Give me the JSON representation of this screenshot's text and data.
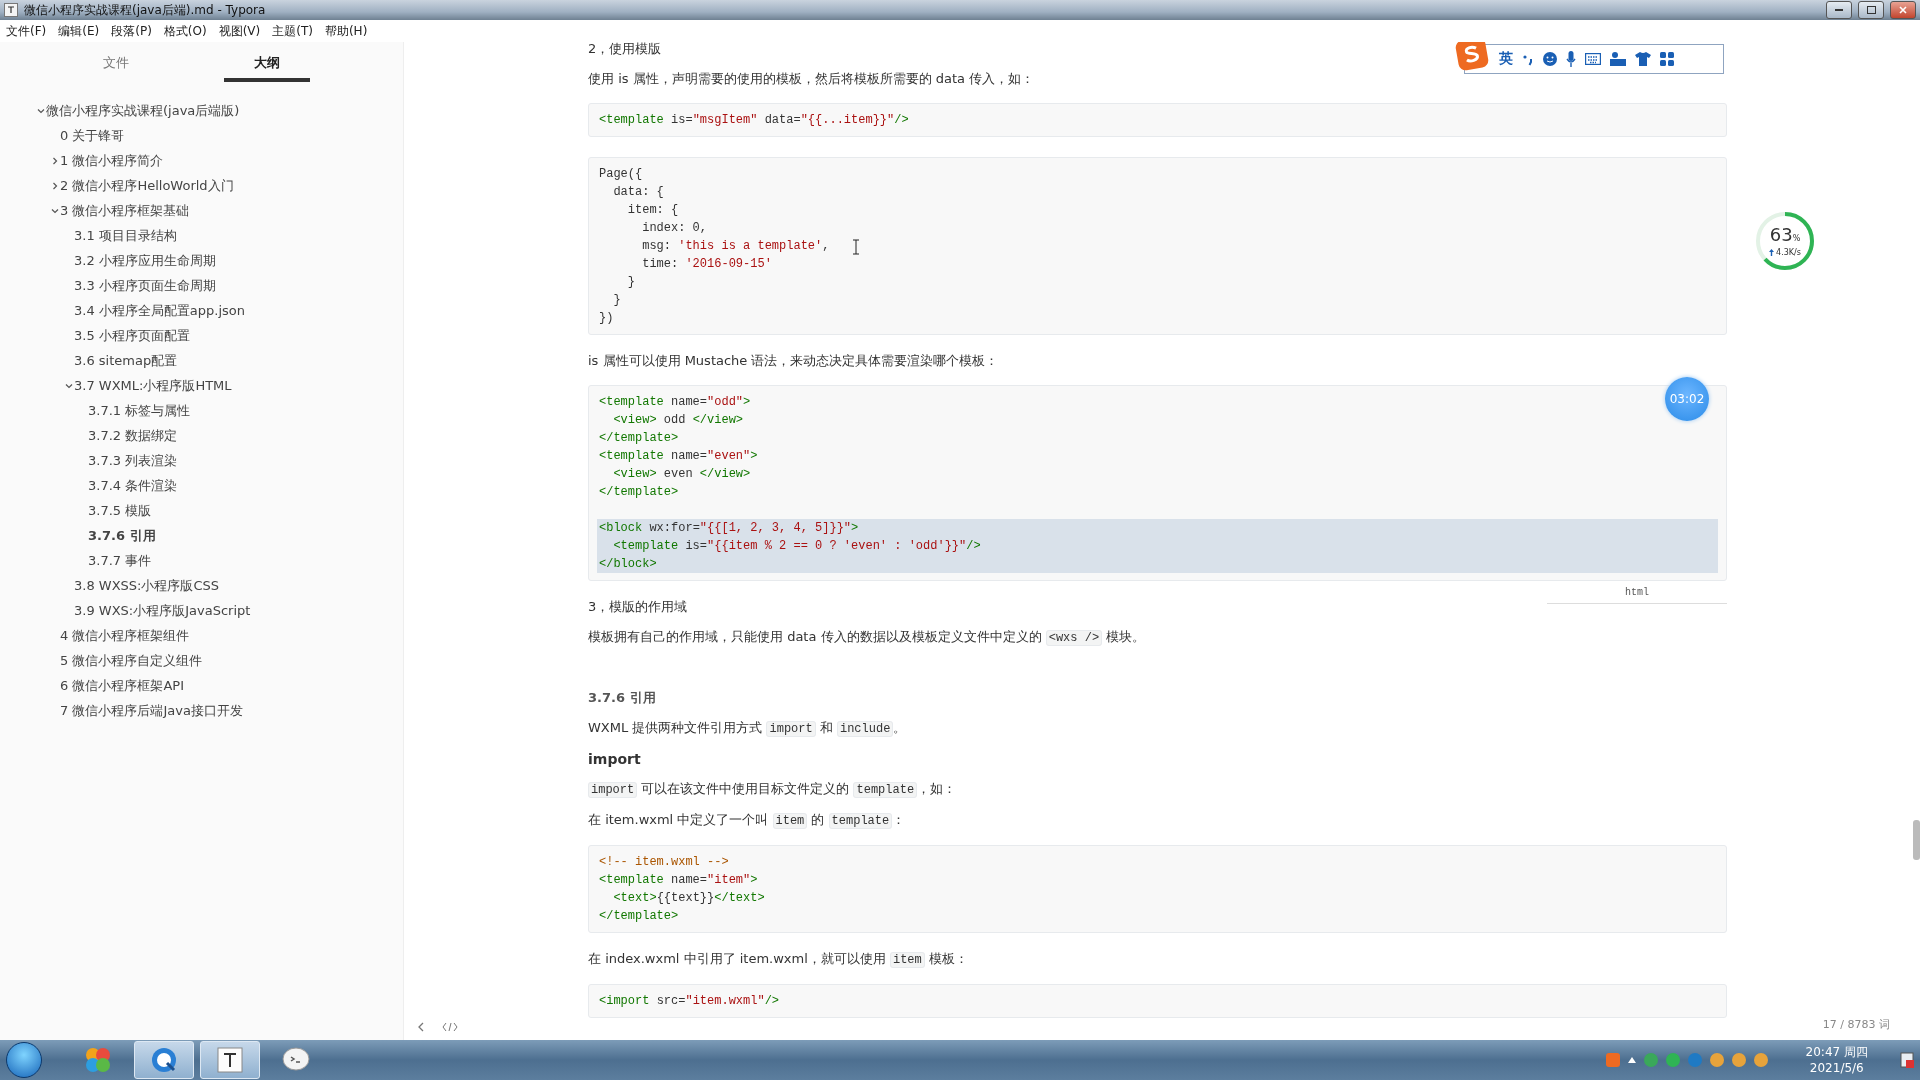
{
  "window": {
    "title": "微信小程序实战课程(java后端).md - Typora"
  },
  "menu": [
    "文件(F)",
    "编辑(E)",
    "段落(P)",
    "格式(O)",
    "视图(V)",
    "主题(T)",
    "帮助(H)"
  ],
  "sidebar": {
    "tabs": [
      {
        "label": "文件",
        "selected": false
      },
      {
        "label": "大纲",
        "selected": true
      }
    ],
    "outline": [
      {
        "label": "微信小程序实战课程(java后端版)",
        "expanded": true,
        "selected": false,
        "children": [
          {
            "label": "0 关于锋哥",
            "selected": false
          },
          {
            "label": "1 微信小程序简介",
            "expanded": false,
            "selected": false
          },
          {
            "label": "2 微信小程序HelloWorld入门",
            "expanded": false,
            "selected": false
          },
          {
            "label": "3 微信小程序框架基础",
            "expanded": true,
            "selected": false,
            "children": [
              {
                "label": "3.1 项目目录结构",
                "selected": false
              },
              {
                "label": "3.2 小程序应用生命周期",
                "selected": false
              },
              {
                "label": "3.3 小程序页面生命周期",
                "selected": false
              },
              {
                "label": "3.4 小程序全局配置app.json",
                "selected": false
              },
              {
                "label": "3.5 小程序页面配置",
                "selected": false
              },
              {
                "label": "3.6 sitemap配置",
                "selected": false
              },
              {
                "label": "3.7 WXML:小程序版HTML",
                "expanded": true,
                "selected": false,
                "children": [
                  {
                    "label": "3.7.1 标签与属性",
                    "selected": false
                  },
                  {
                    "label": "3.7.2 数据绑定",
                    "selected": false
                  },
                  {
                    "label": "3.7.3 列表渲染",
                    "selected": false
                  },
                  {
                    "label": "3.7.4 条件渲染",
                    "selected": false
                  },
                  {
                    "label": "3.7.5 模版",
                    "selected": false
                  },
                  {
                    "label": "3.7.6 引用",
                    "selected": true
                  },
                  {
                    "label": "3.7.7 事件",
                    "selected": false
                  }
                ]
              },
              {
                "label": "3.8 WXSS:小程序版CSS",
                "selected": false
              },
              {
                "label": "3.9 WXS:小程序版JavaScript",
                "selected": false
              }
            ]
          },
          {
            "label": "4 微信小程序框架组件",
            "selected": false
          },
          {
            "label": "5 微信小程序自定义组件",
            "selected": false
          },
          {
            "label": "6 微信小程序框架API",
            "selected": false
          },
          {
            "label": "7 微信小程序后端Java接口开发",
            "selected": false
          }
        ]
      }
    ]
  },
  "document": [
    {
      "kind": "paragraph",
      "parts": [
        {
          "kind": "text",
          "text": "2，使用模版"
        }
      ]
    },
    {
      "kind": "paragraph",
      "parts": [
        {
          "kind": "text",
          "text": "使用 is 属性，声明需要的使用的模板，然后将模板所需要的 data 传入，如："
        }
      ]
    },
    {
      "kind": "code",
      "groups": [
        {
          "selected": false,
          "lines": [
            "<template is=\"msgItem\" data=\"{{...item}}\"/>"
          ]
        }
      ]
    },
    {
      "kind": "code",
      "groups": [
        {
          "selected": false,
          "lines": [
            "Page({",
            "  data: {",
            "    item: {",
            "      index: 0,",
            "      msg: 'this is a template',",
            "      time: '2016-09-15'",
            "    }",
            "  }",
            "})"
          ]
        }
      ]
    },
    {
      "kind": "paragraph",
      "parts": [
        {
          "kind": "text",
          "text": "is 属性可以使用 Mustache 语法，来动态决定具体需要渲染哪个模板："
        }
      ]
    },
    {
      "kind": "code",
      "language": "html",
      "groups": [
        {
          "selected": false,
          "lines": [
            "<template name=\"odd\">",
            "  <view> odd </view>",
            "</template>",
            "<template name=\"even\">",
            "  <view> even </view>",
            "</template>"
          ]
        },
        {
          "selected": true,
          "lines": [
            "<block wx:for=\"{{[1, 2, 3, 4, 5]}}\">",
            "  <template is=\"{{item % 2 == 0 ? 'even' : 'odd'}}\"/>",
            "</block>"
          ]
        }
      ]
    },
    {
      "kind": "paragraph",
      "parts": [
        {
          "kind": "text",
          "text": "3，模版的作用域"
        }
      ]
    },
    {
      "kind": "paragraph",
      "parts": [
        {
          "kind": "text",
          "text": "模板拥有自己的作用域，只能使用 data 传入的数据以及模板定义文件中定义的 "
        },
        {
          "kind": "code",
          "text": "<wxs />"
        },
        {
          "kind": "text",
          "text": " 模块。"
        }
      ]
    },
    {
      "kind": "heading",
      "text": "3.7.6 引用"
    },
    {
      "kind": "paragraph",
      "parts": [
        {
          "kind": "text",
          "text": "WXML 提供两种文件引用方式 "
        },
        {
          "kind": "code",
          "text": "import"
        },
        {
          "kind": "text",
          "text": " 和 "
        },
        {
          "kind": "code",
          "text": "include"
        },
        {
          "kind": "text",
          "text": "。"
        }
      ]
    },
    {
      "kind": "bold",
      "text": "import"
    },
    {
      "kind": "paragraph",
      "parts": [
        {
          "kind": "code",
          "text": "import"
        },
        {
          "kind": "text",
          "text": " 可以在该文件中使用目标文件定义的 "
        },
        {
          "kind": "code",
          "text": "template"
        },
        {
          "kind": "text",
          "text": "，如："
        }
      ]
    },
    {
      "kind": "paragraph",
      "parts": [
        {
          "kind": "text",
          "text": "在 item.wxml 中定义了一个叫 "
        },
        {
          "kind": "code",
          "text": "item"
        },
        {
          "kind": "text",
          "text": " 的 "
        },
        {
          "kind": "code",
          "text": "template"
        },
        {
          "kind": "text",
          "text": "："
        }
      ]
    },
    {
      "kind": "code",
      "groups": [
        {
          "selected": false,
          "lines": [
            "<!-- item.wxml -->",
            "<template name=\"item\">",
            "  <text>{{text}}</text>",
            "</template>"
          ]
        }
      ]
    },
    {
      "kind": "paragraph",
      "parts": [
        {
          "kind": "text",
          "text": "在 index.wxml 中引用了 item.wxml，就可以使用 "
        },
        {
          "kind": "code",
          "text": "item"
        },
        {
          "kind": "text",
          "text": " 模板："
        }
      ]
    },
    {
      "kind": "code",
      "groups": [
        {
          "selected": false,
          "lines": [
            "<import src=\"item.wxml\"/>"
          ]
        }
      ]
    }
  ],
  "status_bar": {
    "word_count": "17 / 8783 词"
  },
  "ime_toolbar": {
    "mode": "英"
  },
  "speed_widget": {
    "value": "63",
    "unit": "%",
    "speed": "4.3K/s",
    "level": 0.63
  },
  "timer_bubble": {
    "time": "03:02"
  },
  "taskbar": {
    "apps": [
      {
        "kind": "pinwheel",
        "selected": false
      },
      {
        "kind": "browser",
        "selected": true
      },
      {
        "kind": "typora",
        "selected": true
      },
      {
        "kind": "chat",
        "selected": false
      }
    ],
    "clock": {
      "time": "20:47 周四",
      "date": "2021/5/6"
    }
  }
}
